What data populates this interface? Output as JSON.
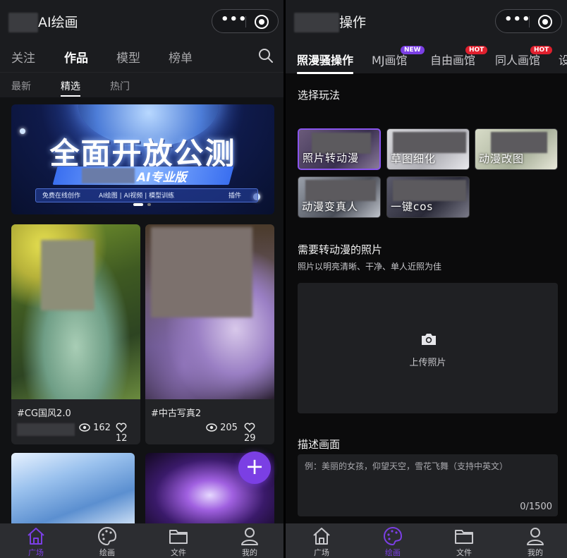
{
  "left": {
    "title": "AI绘画",
    "main_tabs": [
      "关注",
      "作品",
      "模型",
      "榜单"
    ],
    "active_main_tab": "作品",
    "sub_tabs": [
      "最新",
      "精选",
      "热门"
    ],
    "active_sub_tab": "精选",
    "banner": {
      "headline": "全面开放公测",
      "product": "AI专业版",
      "features": [
        "免费在线创作",
        "AI绘图 | AI视频 | 模型训练",
        "插件"
      ]
    },
    "cards": [
      {
        "tag": "#CG国风2.0",
        "views": "162",
        "likes": "12"
      },
      {
        "tag": "#中古写真2",
        "views": "205",
        "likes": "29"
      }
    ],
    "fab_label": "+"
  },
  "right": {
    "title": "操作",
    "tabs": [
      {
        "label": "照漫骚操作",
        "badge": ""
      },
      {
        "label": "MJ画馆",
        "badge": "NEW"
      },
      {
        "label": "自由画馆",
        "badge": "HOT"
      },
      {
        "label": "同人画馆",
        "badge": "HOT"
      },
      {
        "label": "设",
        "badge": ""
      }
    ],
    "play_section_title": "选择玩法",
    "plays": [
      "照片转动漫",
      "草图细化",
      "动漫改图",
      "动漫变真人",
      "一键cos"
    ],
    "active_play": "照片转动漫",
    "upload_section_title": "需要转动漫的照片",
    "upload_hint": "照片以明亮清晰、干净、单人近照为佳",
    "upload_label": "上传照片",
    "describe_title": "描述画面",
    "describe_placeholder": "例：美丽的女孩，仰望天空，雪花飞舞（支持中英文）",
    "describe_count": "0/1500"
  },
  "bottom_nav": [
    "广场",
    "绘画",
    "文件",
    "我的"
  ],
  "colors": {
    "accent": "#7b3fe4",
    "hot": "#e0202e",
    "bar": "#2c2d31"
  }
}
